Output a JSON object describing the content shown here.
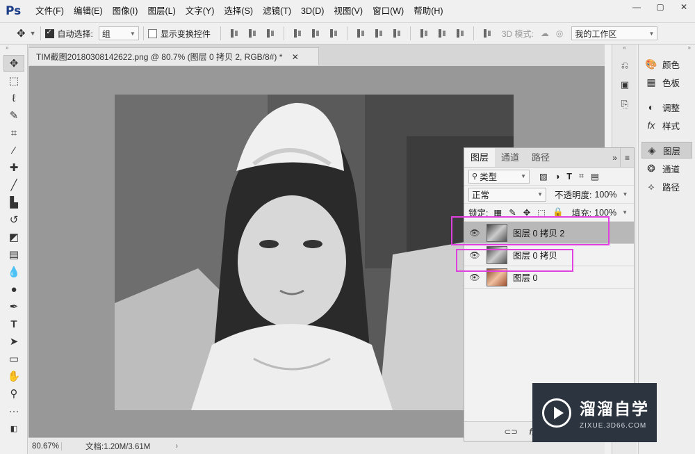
{
  "app": {
    "logo": "Ps"
  },
  "menu": [
    "文件(F)",
    "编辑(E)",
    "图像(I)",
    "图层(L)",
    "文字(Y)",
    "选择(S)",
    "滤镜(T)",
    "3D(D)",
    "视图(V)",
    "窗口(W)",
    "帮助(H)"
  ],
  "window_controls": {
    "minimize": "—",
    "restore": "▢",
    "close": "✕"
  },
  "options": {
    "auto_select_label": "自动选择:",
    "auto_select_value": "组",
    "show_transform_label": "显示变换控件",
    "mode_3d_label": "3D 模式:",
    "workspace": "我的工作区"
  },
  "document": {
    "tab_title": "TIM截图20180308142622.png @ 80.7% (图层 0 拷贝 2, RGB/8#) *",
    "zoom": "80.67%",
    "doc_size": "文档:1.20M/3.61M"
  },
  "right_panel": {
    "items": [
      {
        "label": "颜色",
        "icon": "palette-icon"
      },
      {
        "label": "色板",
        "icon": "swatches-icon"
      },
      {
        "label": "调整",
        "icon": "adjust-icon"
      },
      {
        "label": "样式",
        "icon": "fx-icon"
      },
      {
        "label": "图层",
        "icon": "layers-icon"
      },
      {
        "label": "通道",
        "icon": "channels-icon"
      },
      {
        "label": "路径",
        "icon": "paths-icon"
      }
    ]
  },
  "layers_panel": {
    "tabs": [
      "图层",
      "通道",
      "路径"
    ],
    "kind_filter": "类型",
    "blend_mode": "正常",
    "opacity_label": "不透明度:",
    "opacity_value": "100%",
    "lock_label": "锁定:",
    "fill_label": "填充:",
    "fill_value": "100%",
    "layers": [
      {
        "name": "图层 0 拷贝 2",
        "selected": true
      },
      {
        "name": "图层 0 拷贝",
        "selected": false
      },
      {
        "name": "图层 0",
        "selected": false
      }
    ]
  },
  "watermark": {
    "title": "溜溜自学",
    "subtitle": "ZIXUE.3D66.COM"
  },
  "colors": {
    "highlight": "#e040e0",
    "canvas_bg": "#989898",
    "watermark_bg": "#2c3440"
  }
}
